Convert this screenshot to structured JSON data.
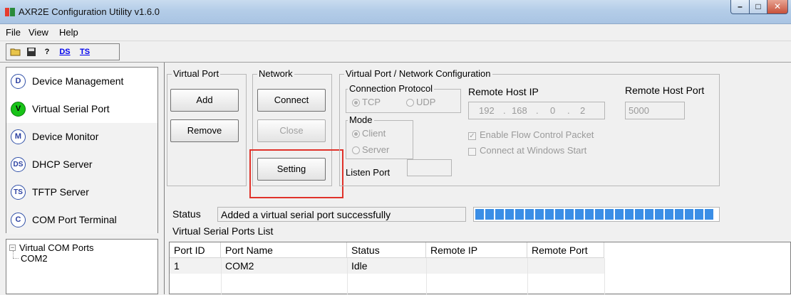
{
  "window": {
    "title": "AXR2E Configuration Utility v1.6.0"
  },
  "menu": {
    "file": "File",
    "view": "View",
    "help": "Help"
  },
  "toolbar": {
    "ds": "DS",
    "ts": "TS"
  },
  "nav": {
    "items": [
      {
        "icon": "D",
        "label": "Device Management"
      },
      {
        "icon": "V",
        "label": "Virtual Serial Port"
      },
      {
        "icon": "M",
        "label": "Device Monitor"
      },
      {
        "icon": "DS",
        "label": "DHCP Server"
      },
      {
        "icon": "TS",
        "label": "TFTP Server"
      },
      {
        "icon": "C",
        "label": "COM Port Terminal"
      }
    ]
  },
  "tree": {
    "root": "Virtual COM Ports",
    "child": "COM2"
  },
  "virtual_port": {
    "title": "Virtual Port",
    "add": "Add",
    "remove": "Remove"
  },
  "network": {
    "title": "Network",
    "connect": "Connect",
    "close": "Close",
    "setting": "Setting"
  },
  "config": {
    "title": "Virtual Port / Network Configuration",
    "protocol_title": "Connection Protocol",
    "tcp": "TCP",
    "udp": "UDP",
    "mode_title": "Mode",
    "client": "Client",
    "server": "Server",
    "listen_port_label": "Listen Port",
    "listen_port_value": "",
    "remote_ip_label": "Remote Host IP",
    "ip1": "192",
    "ip2": "168",
    "ip3": "0",
    "ip4": "2",
    "remote_port_label": "Remote Host Port",
    "remote_port_value": "5000",
    "flow_control": "Enable Flow Control Packet",
    "connect_start": "Connect at Windows Start"
  },
  "status": {
    "label": "Status",
    "text": "Added a virtual serial port successfully",
    "progress_fraction": 1.0
  },
  "list": {
    "title": "Virtual Serial Ports List",
    "columns": [
      "Port ID",
      "Port Name",
      "Status",
      "Remote IP",
      "Remote Port"
    ],
    "rows": [
      {
        "id": "1",
        "name": "COM2",
        "status": "Idle",
        "remote_ip": "",
        "remote_port": ""
      }
    ]
  },
  "colors": {
    "accent": "#3b8ee6",
    "active_nav": "#18c418",
    "highlight": "#e0322a"
  }
}
